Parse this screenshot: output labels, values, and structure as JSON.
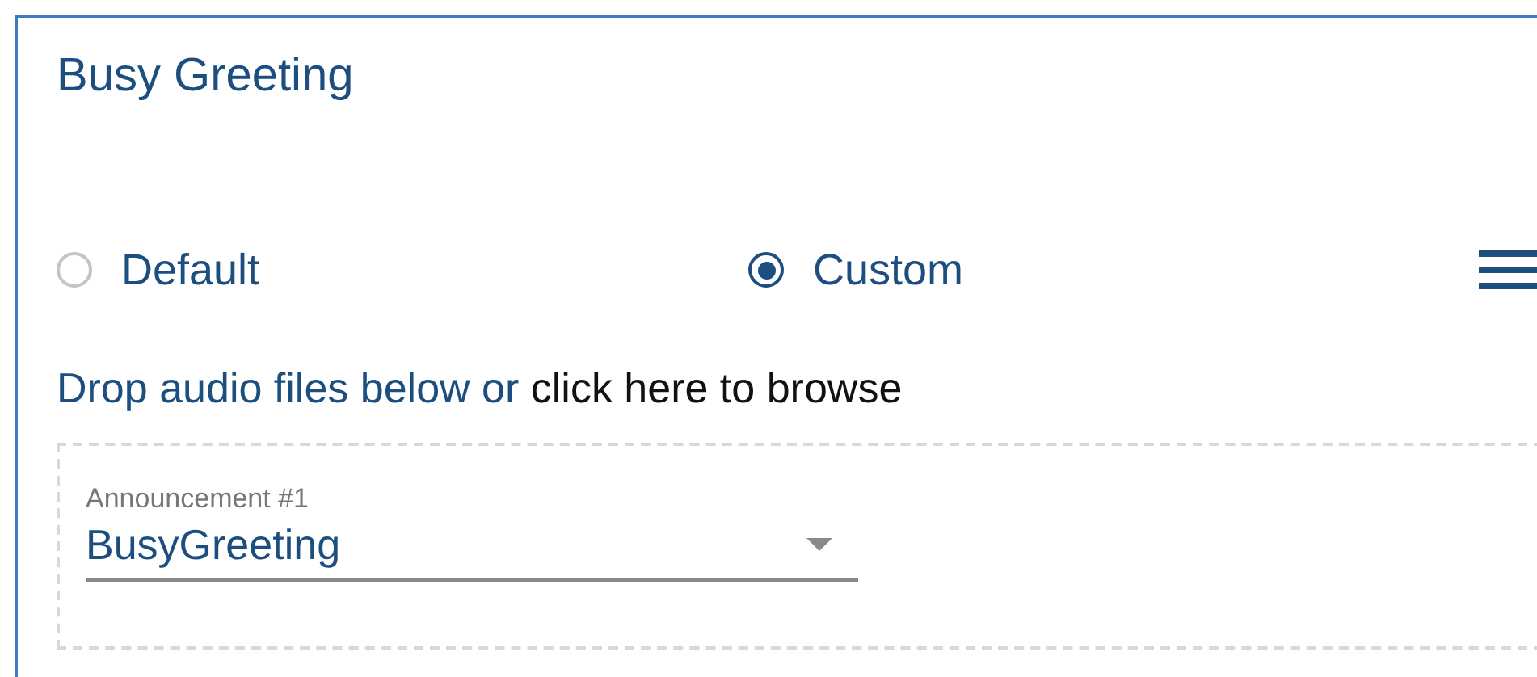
{
  "title": "Busy Greeting",
  "options": [
    {
      "label": "Default",
      "selected": false
    },
    {
      "label": "Custom",
      "selected": true
    }
  ],
  "drop_hint": {
    "text": "Drop audio files below or ",
    "link": "click here to browse"
  },
  "announcement": {
    "label": "Announcement #1",
    "value": "BusyGreeting"
  }
}
